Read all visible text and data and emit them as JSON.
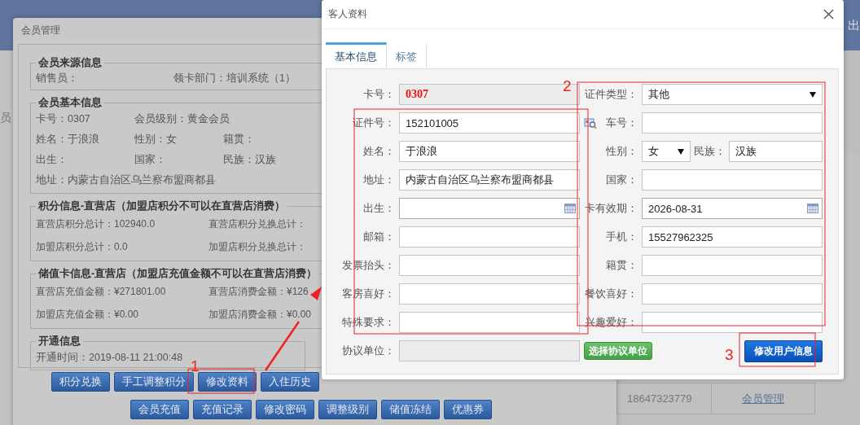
{
  "background_page": {
    "header_link": "出",
    "side_item": "员",
    "table_rows": [
      {
        "phone": "18647323779",
        "link": "会员管理"
      }
    ]
  },
  "member_dialog": {
    "title": "会员管理",
    "sections": [
      {
        "kind": "source",
        "legend": "会员来源信息",
        "rows": [
          [
            "销售员：",
            "领卡部门：培训系统（1）"
          ]
        ]
      },
      {
        "kind": "three_col",
        "legend": "会员基本信息",
        "rows": [
          [
            "卡号：0307",
            "会员级别：黄金会员"
          ],
          [
            "姓名：于浪浪",
            "性别：女",
            "籍贯："
          ],
          [
            "出生：",
            "国家：",
            "民族：汉族"
          ],
          [
            "地址：内蒙古自治区乌兰察布盟商都县"
          ]
        ]
      },
      {
        "kind": "two_col",
        "legend": "积分信息-直营店（加盟店积分不可以在直营店消费）",
        "rows": [
          [
            "直营店积分总计：102940.0",
            "直营店积分兑换总计："
          ],
          [
            "加盟店积分总计：0.0",
            "加盟店积分兑换总计："
          ]
        ]
      },
      {
        "kind": "two_col",
        "legend": "储值卡信息-直营店（加盟店充值金额不可以在直营店消费）",
        "rows": [
          [
            "直营店充值金额：¥271801.00",
            "直营店消费金额：¥126"
          ],
          [
            "加盟店充值金额：¥0.00",
            "加盟店消费金额：¥0.00"
          ]
        ]
      }
    ],
    "opening": {
      "legend": "开通信息",
      "text": "开通时间：2019-08-11 21:00:48"
    },
    "buttons_row_1": [
      "积分兑换",
      "手工调整积分",
      "修改资料",
      "入住历史"
    ],
    "buttons_row_2": [
      "会员充值",
      "充值记录",
      "修改密码",
      "调整级别",
      "储值冻结",
      "优惠券"
    ]
  },
  "guest_dialog": {
    "title": "客人资料",
    "tabs": [
      {
        "label": "基本信息",
        "selected": true
      },
      {
        "label": "标签",
        "selected": false
      }
    ],
    "left_fields": [
      {
        "label": "卡号：",
        "value": "0307",
        "kind": "readonly"
      },
      {
        "label": "证件号：",
        "value": "152101005",
        "kind": "text"
      },
      {
        "label": "姓名：",
        "value": "于浪浪",
        "kind": "text"
      },
      {
        "label": "地址：",
        "value": "内蒙古自治区乌兰察布盟商都县",
        "kind": "text"
      },
      {
        "label": "出生：",
        "kind": "date"
      },
      {
        "label": "邮箱：",
        "kind": "text"
      },
      {
        "label": "发票抬头：",
        "kind": "text"
      },
      {
        "label": "客房喜好：",
        "kind": "text"
      },
      {
        "label": "特殊要求：",
        "kind": "text"
      },
      {
        "label": "协议单位：",
        "kind": "disabled"
      }
    ],
    "right_fields": [
      {
        "label": "证件类型：",
        "value": "其他",
        "kind": "select"
      },
      {
        "label": "车号：",
        "kind": "lookup"
      },
      {
        "label": "性别：",
        "value": "女",
        "kind": "select_pair",
        "pair_label": "民族：",
        "pair_value": "汉族"
      },
      {
        "label": "国家：",
        "kind": "text"
      },
      {
        "label": "卡有效期：",
        "value": "2026-08-31",
        "kind": "date"
      },
      {
        "label": "手机：",
        "value": "15527962325",
        "kind": "text"
      },
      {
        "label": "籍贯：",
        "kind": "text"
      },
      {
        "label": "餐饮喜好：",
        "kind": "text"
      },
      {
        "label": "兴趣爱好：",
        "kind": "text"
      }
    ],
    "select_unit_button": "选择协议单位",
    "submit_button": "修改用户信息"
  },
  "annotations": {
    "numbers": [
      "1",
      "2",
      "3"
    ]
  }
}
